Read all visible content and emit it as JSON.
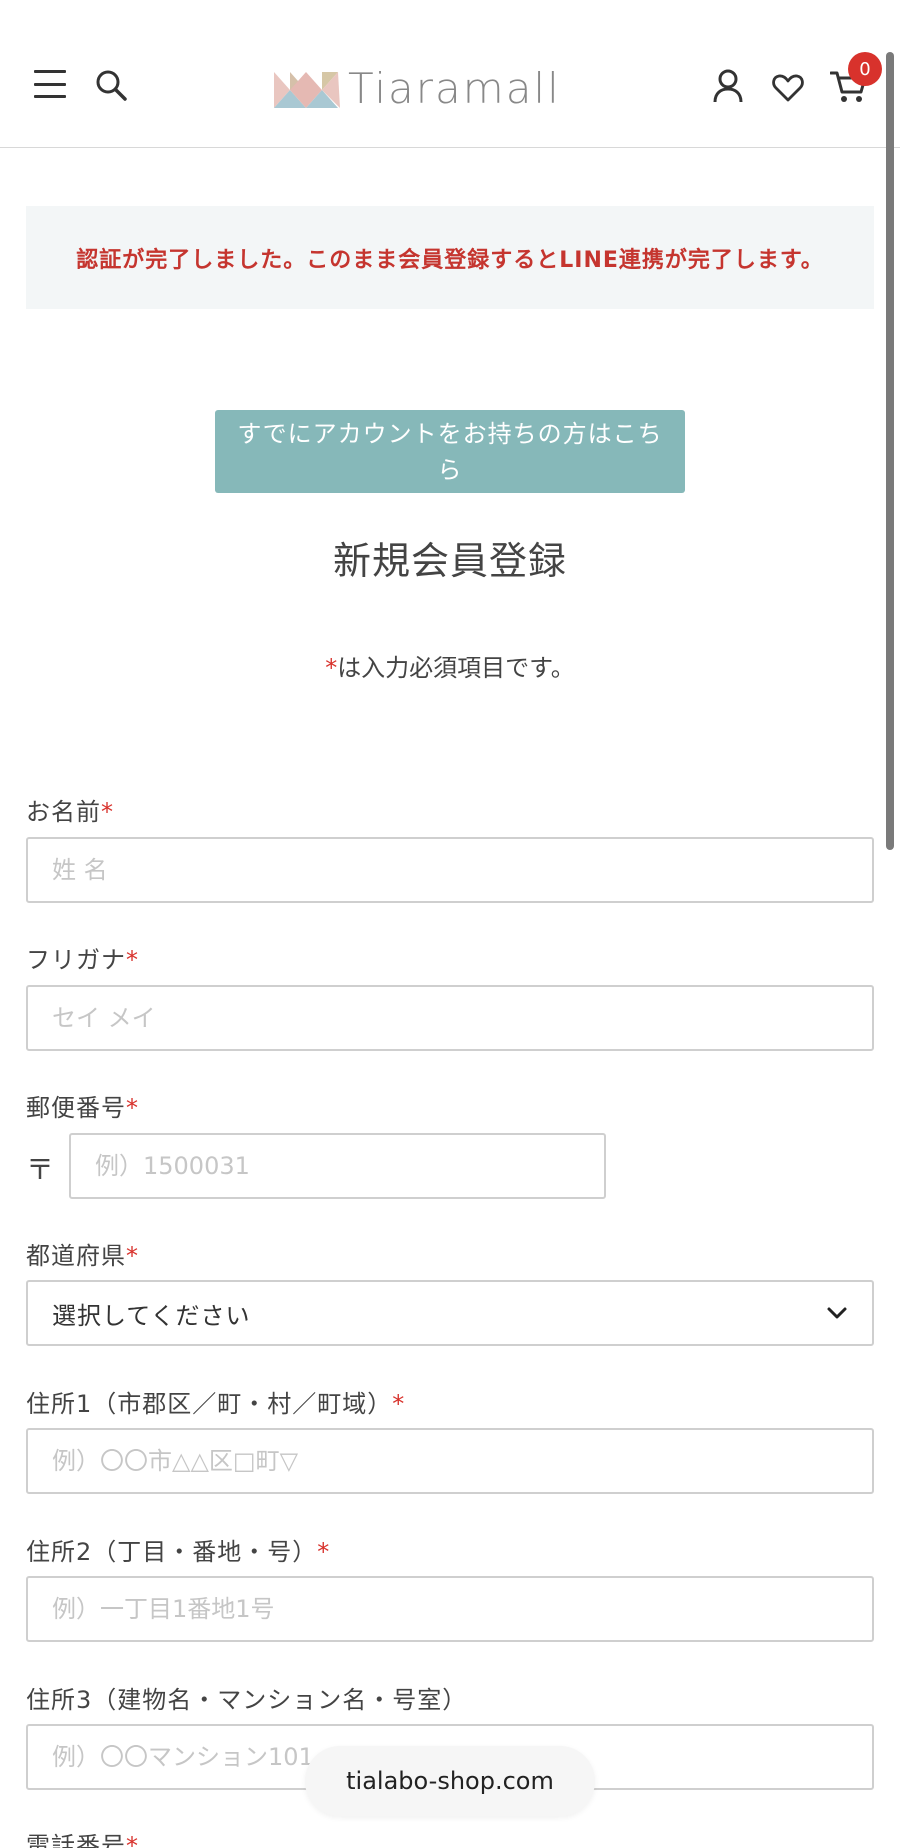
{
  "header": {
    "logo_text": "Tiaramall",
    "cart_count": "0"
  },
  "notice": {
    "text": "認証が完了しました。このまま会員登録するとLINE連携が完了します。"
  },
  "login_link": {
    "label": "すでにアカウントをお持ちの方はこちら"
  },
  "page_title": "新規会員登録",
  "required_note": {
    "mark": "*",
    "text": "は入力必須項目です。"
  },
  "form": {
    "name": {
      "label": "お名前",
      "placeholder": "姓 名"
    },
    "kana": {
      "label": "フリガナ",
      "placeholder": "セイ メイ"
    },
    "postal": {
      "label": "郵便番号",
      "mark": "〒",
      "placeholder": "例）1500031"
    },
    "prefecture": {
      "label": "都道府県",
      "value": "選択してください"
    },
    "address1": {
      "label": "住所1（市郡区／町・村／町域）",
      "placeholder": "例）〇〇市△△区□町▽"
    },
    "address2": {
      "label": "住所2（丁目・番地・号）",
      "placeholder": "例）一丁目1番地1号"
    },
    "address3": {
      "label": "住所3（建物名・マンション名・号室）",
      "placeholder": "例）〇〇マンション101"
    },
    "phone": {
      "label": "電話番号"
    },
    "required_mark": "*"
  },
  "browser": {
    "domain": "tialabo-shop.com"
  },
  "colors": {
    "accent": "#86b8b9",
    "notice_text": "#c5352f",
    "required": "#d8322c"
  }
}
